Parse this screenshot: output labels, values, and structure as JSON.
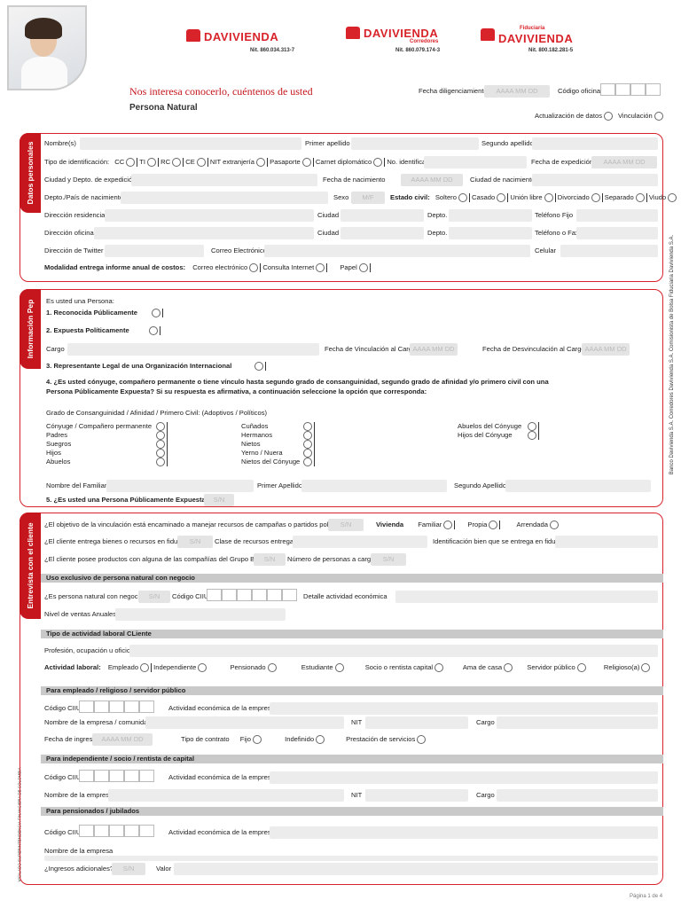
{
  "header": {
    "logos": [
      {
        "brand": "DAVIVIENDA",
        "nit": "Nit. 860.034.313-7",
        "sub": ""
      },
      {
        "brand": "DAVIVIENDA",
        "nit": "Nit. 860.079.174-3",
        "sub": "Corredores"
      },
      {
        "brand": "DAVIVIENDA",
        "nit": "Nit. 800.182.281-5",
        "sub": "Fiduciaria"
      }
    ],
    "tagline": "Nos interesa conocerlo, cuéntenos de usted",
    "subtitle": "Persona Natural",
    "fecha_label": "Fecha diligenciamiento",
    "date_placeholder": "AAAA MM DD",
    "codigo_oficina": "Código oficina",
    "actualizacion": "Actualización de datos",
    "vinculacion": "Vinculación"
  },
  "side_text": {
    "right": "Banco Davivienda S.A.   Corredores Davivienda S.A. Comisionista de Bolsa   Fiduciaria Davivienda S.A.",
    "left": "VIGILADO   SUPERINTENDENCIA FINANCIERA DE COLOMBIA"
  },
  "sections": {
    "personal": "Datos personales",
    "pep": "Información Pep",
    "entrevista": "Entrevista con el cliente"
  },
  "personal": {
    "nombre": "Nombre(s)",
    "primer_apellido": "Primer apellido",
    "segundo_apellido": "Segundo apellido",
    "tipo_id": "Tipo de identificación:",
    "tipos": [
      "CC",
      "TI",
      "RC",
      "CE",
      "NIT extranjería",
      "Pasaporte",
      "Carnet diplomático"
    ],
    "no_id": "No. identificación",
    "fecha_expedicion": "Fecha de expedición",
    "ciudad_expedicion": "Ciudad y Depto. de expedición",
    "fecha_nacimiento": "Fecha de nacimiento",
    "ciudad_nacimiento": "Ciudad de nacimiento",
    "pais_nacimiento": "Depto./País de nacimiento",
    "sexo": "Sexo",
    "sexo_ph": "M/F",
    "estado_civil": "Estado civil:",
    "estados": [
      "Soltero",
      "Casado",
      "Unión libre",
      "Divorciado",
      "Separado",
      "Viudo"
    ],
    "dir_residencia": "Dirección residencia",
    "ciudad": "Ciudad",
    "depto": "Depto.",
    "tel_fijo": "Teléfono Fijo",
    "dir_oficina": "Dirección oficina",
    "tel_fax": "Teléfono o Fax",
    "twitter": "Dirección de Twitter",
    "correo": "Correo Electrónico",
    "celular": "Celular",
    "modalidad": "Modalidad entrega informe anual de costos:",
    "modalidades": [
      "Correo electrónico",
      "Consulta Internet",
      "Papel"
    ]
  },
  "pep": {
    "intro": "Es usted una Persona:",
    "q1": "1. Reconocida Públicamente",
    "q2": "2. Expuesta Políticamente",
    "cargo": "Cargo",
    "fecha_vinc": "Fecha de Vinculación al Cargo",
    "fecha_desv": "Fecha de Desvinculación al Cargo",
    "q3": "3. Representante Legal de una Organización Internacional",
    "q4a": "4. ¿Es usted cónyuge, compañero permanente o tiene vínculo hasta segundo grado de consanguinidad, segundo grado de afinidad y/o primero civil con una",
    "q4b": "Persona Públicamente Expuesta? Si su respuesta es afirmativa, a continuación seleccione la opción que corresponda:",
    "grado": "Grado de Consanguinidad / Afinidad / Primero Civil: (Adoptivos / Políticos)",
    "col1": [
      "Cónyuge / Compañero permanente",
      "Padres",
      "Suegros",
      "Hijos",
      "Abuelos"
    ],
    "col2": [
      "Cuñados",
      "Hermanos",
      "Nietos",
      "Yerno / Nuera",
      "Nietos del Cónyuge"
    ],
    "col3": [
      "Abuelos del Cónyuge",
      "Hijos del Cónyuge"
    ],
    "nombre_familiar": "Nombre del Familiar",
    "primer_apellido": "Primer Apellido",
    "segundo_apellido": "Segundo Apellido",
    "q5": "5. ¿Es usted una Persona Públicamente Expuesta?",
    "sn": "S/N"
  },
  "entrevista": {
    "q_objetivo": "¿El objetivo de la vinculación está encaminado a manejar recursos de campañas o partidos políticos?",
    "vivienda": "Vivienda",
    "viviendas": [
      "Familiar",
      "Propia",
      "Arrendada"
    ],
    "q_fiducia": "¿El cliente entrega bienes o recursos en fiducia?",
    "clase_recursos": "Clase de recursos entregados",
    "ident_bien": "Identificación bien que se entrega en fiducia",
    "q_productos": "¿El cliente posee productos con alguna de las compañías del Grupo Bolívar?",
    "num_personas": "Número de personas a cargo",
    "bar_negocio": "Uso exclusivo de persona natural con negocio",
    "q_negocio": "¿Es persona natural con negocio?",
    "codigo_ciiu": "Código CIIU",
    "detalle_actividad": "Detalle actividad económica",
    "nivel_ventas": "Nivel de ventas Anuales",
    "bar_actividad": "Tipo de actividad laboral CLiente",
    "profesion": "Profesión, ocupación u oficio",
    "actividad_laboral": "Actividad laboral:",
    "actividades": [
      "Empleado",
      "Independiente",
      "Pensionado",
      "Estudiante",
      "Socio o rentista capital",
      "Ama de casa",
      "Servidor público",
      "Religioso(a)"
    ],
    "bar_empleado": "Para empleado / religioso / servidor público",
    "actividad_empresa": "Actividad económica de la empresa",
    "nombre_empresa_comunidad": "Nombre de la empresa / comunidad",
    "nit": "NIT",
    "cargo": "Cargo",
    "fecha_ingreso": "Fecha de ingreso",
    "tipo_contrato": "Tipo de contrato",
    "contratos": [
      "Fijo",
      "Indefinido",
      "Prestación de servicios"
    ],
    "bar_independiente": "Para independiente / socio / rentista de capital",
    "nombre_empresa": "Nombre de la empresa",
    "bar_pensionado": "Para pensionados / jubilados",
    "ingresos_adicionales": "¿Ingresos adicionales?",
    "valor": "Valor"
  },
  "footer": {
    "page": "Página 1 de 4"
  }
}
